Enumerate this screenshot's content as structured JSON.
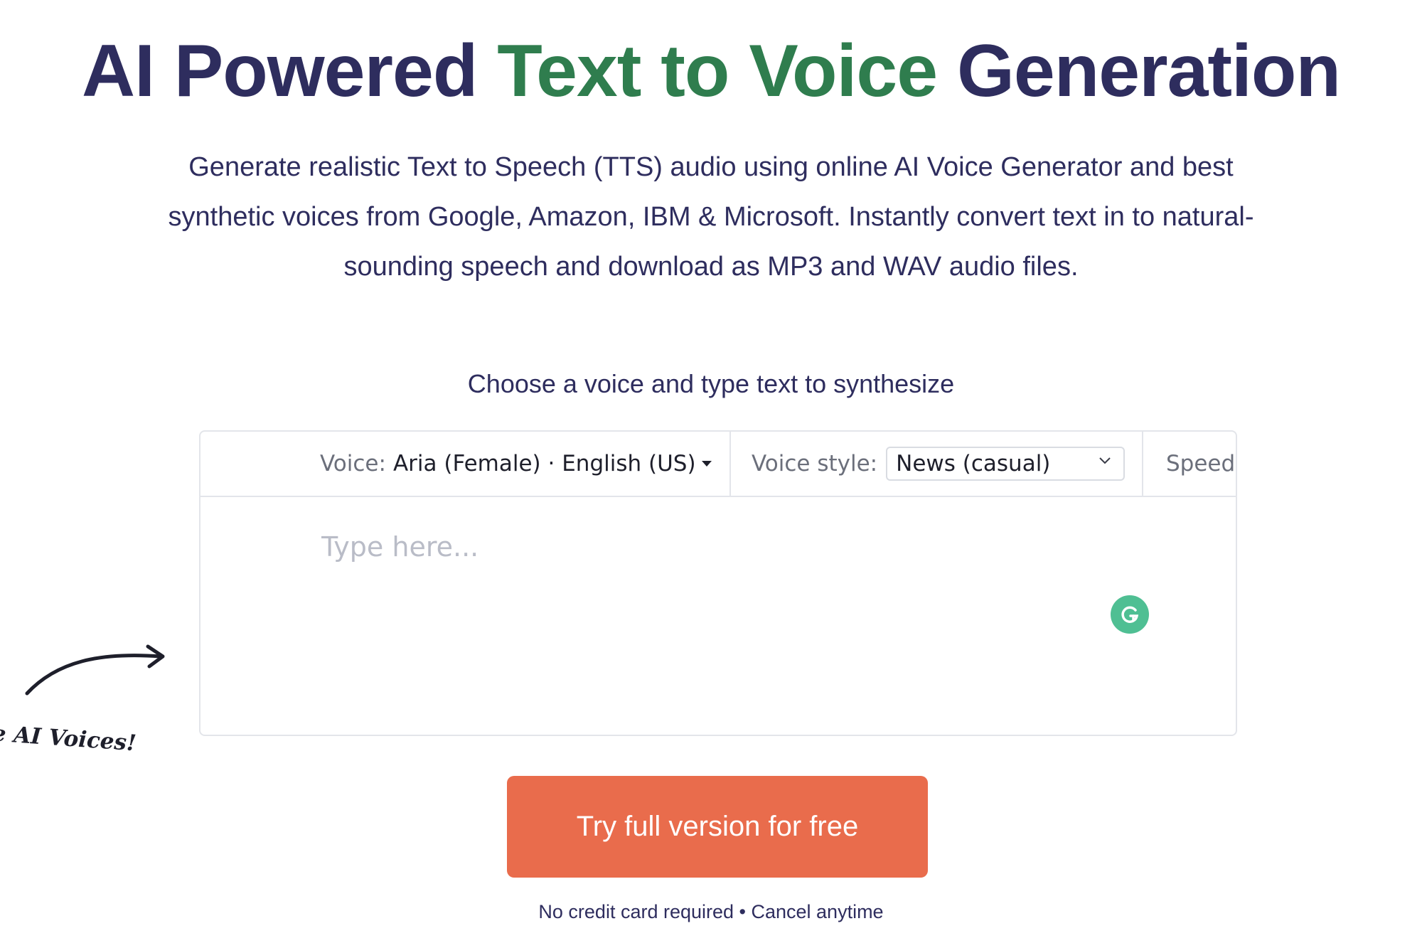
{
  "hero": {
    "title_part1": "AI Powered ",
    "title_highlight": "Text to Voice",
    "title_part2": " Generation",
    "description": "Generate realistic Text to Speech (TTS) audio using online AI Voice Generator and best synthetic voices from Google, Amazon, IBM & Microsoft. Instantly convert text in to natural-sounding speech and download as MP3 and WAV audio files."
  },
  "widget": {
    "prompt": "Choose a voice and type text to synthesize",
    "voice_label": "Voice:",
    "voice_value": "Aria (Female) · English (US)",
    "voice_style_label": "Voice style:",
    "voice_style_value": "News (casual)",
    "speed_label": "Speed:",
    "text_placeholder": "Type here..."
  },
  "side_note": {
    "text": "ce AI Voices!"
  },
  "cta": {
    "button_label": "Try full version for free",
    "note": "No credit card required • Cancel anytime"
  },
  "colors": {
    "heading_dark": "#2e2d5e",
    "heading_green": "#2f7d4e",
    "cta_orange": "#e96c4c",
    "grammarly_green": "#4fbf93"
  },
  "icons": {
    "voice_dropdown": "caret-down-icon",
    "style_dropdown": "chevron-down-icon",
    "grammarly": "grammarly-icon",
    "arrow": "curved-arrow-icon"
  }
}
